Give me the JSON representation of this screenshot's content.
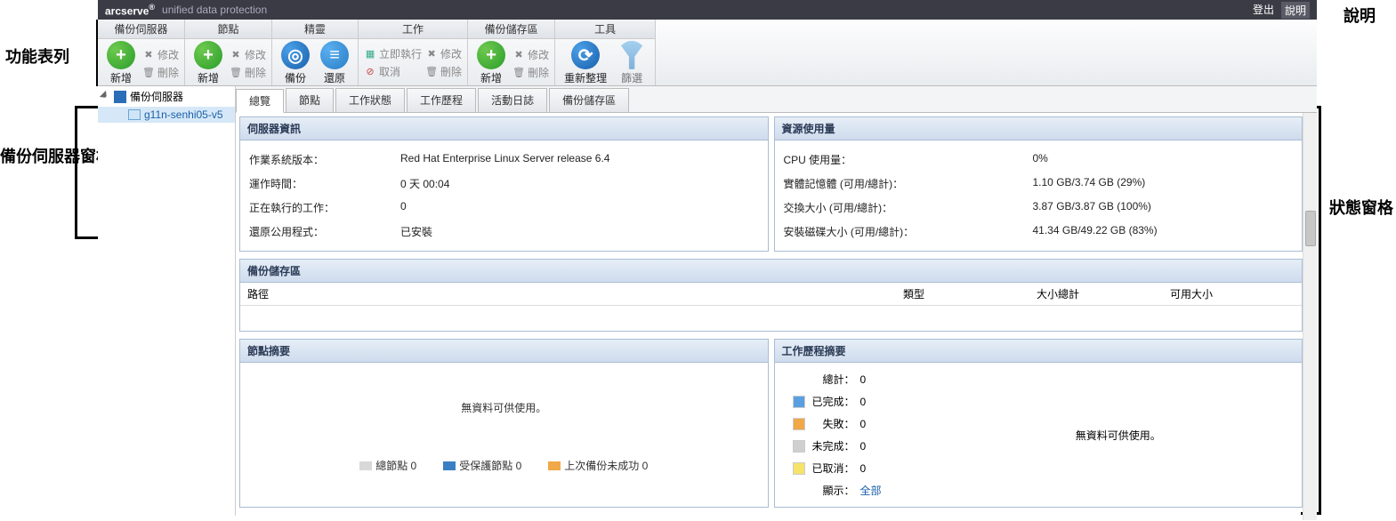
{
  "annotations": {
    "toolbar": "功能表列",
    "sidebar": "備份伺服器窗格",
    "status": "狀態窗格",
    "help": "說明"
  },
  "header": {
    "brand": "arcserve",
    "sub": "unified data protection",
    "logout": "登出",
    "help": "說明"
  },
  "toolbar": {
    "groups": {
      "backup_server": "備份伺服器",
      "node": "節點",
      "wizard": "精靈",
      "job": "工作",
      "storage": "備份儲存區",
      "tool": "工具"
    },
    "add": "新增",
    "modify": "修改",
    "delete": "刪除",
    "backup": "備份",
    "restore": "還原",
    "run_now": "立即執行",
    "cancel": "取消",
    "refresh": "重新整理",
    "filter": "篩選"
  },
  "tree": {
    "root": "備份伺服器",
    "node": "g11n-senhi05-v5"
  },
  "tabs": {
    "overview": "總覽",
    "node": "節點",
    "job_status": "工作狀態",
    "job_history": "工作歷程",
    "activity_log": "活動日誌",
    "storage": "備份儲存區"
  },
  "server_info": {
    "title": "伺服器資訊",
    "os_label": "作業系統版本：",
    "os_value": "Red Hat Enterprise Linux Server release 6.4",
    "uptime_label": "運作時間：",
    "uptime_value": "0 天 00:04",
    "running_jobs_label": "正在執行的工作：",
    "running_jobs_value": "0",
    "restore_util_label": "還原公用程式：",
    "restore_util_value": "已安裝"
  },
  "resource": {
    "title": "資源使用量",
    "cpu_label": "CPU 使用量：",
    "cpu_value": "0%",
    "mem_label": "實體記憶體 (可用/總計)：",
    "mem_value": "1.10 GB/3.74 GB (29%)",
    "swap_label": "交換大小 (可用/總計)：",
    "swap_value": "3.87 GB/3.87 GB (100%)",
    "disk_label": "安裝磁碟大小 (可用/總計)：",
    "disk_value": "41.34 GB/49.22 GB (83%)"
  },
  "storage": {
    "title": "備份儲存區",
    "col_path": "路徑",
    "col_type": "類型",
    "col_total": "大小總計",
    "col_avail": "可用大小"
  },
  "node_summary": {
    "title": "節點摘要",
    "empty": "無資料可供使用。",
    "total_nodes": "總節點 0",
    "protected": "受保護節點 0",
    "last_fail": "上次備份未成功 0"
  },
  "job_history": {
    "title": "工作歷程摘要",
    "total_label": "總計：",
    "total_value": "0",
    "done_label": "已完成：",
    "done_value": "0",
    "fail_label": "失敗：",
    "fail_value": "0",
    "incomplete_label": "未完成：",
    "incomplete_value": "0",
    "cancel_label": "已取消：",
    "cancel_value": "0",
    "show_label": "顯示：",
    "show_value": "全部",
    "empty": "無資料可供使用。"
  },
  "colors": {
    "total_nodes": "#d8d8d8",
    "protected": "#3a7fc4",
    "last_fail": "#f0a848",
    "done": "#5aa0e0",
    "fail": "#f0a848",
    "incomplete": "#cfcfcf",
    "cancel": "#f5e36a"
  }
}
